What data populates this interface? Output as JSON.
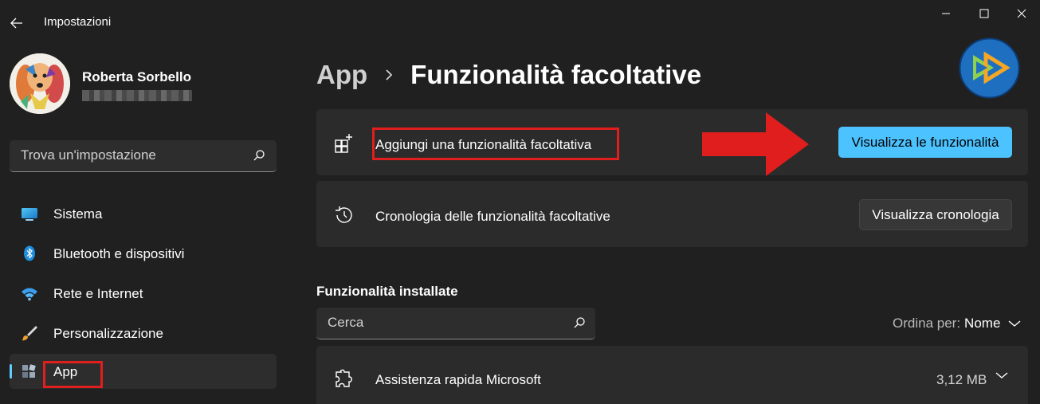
{
  "window": {
    "title": "Impostazioni"
  },
  "user": {
    "name": "Roberta Sorbello"
  },
  "sidebar": {
    "search_placeholder": "Trova un'impostazione",
    "items": [
      {
        "label": "Sistema",
        "icon": "monitor-icon"
      },
      {
        "label": "Bluetooth e dispositivi",
        "icon": "bluetooth-icon"
      },
      {
        "label": "Rete e Internet",
        "icon": "wifi-icon"
      },
      {
        "label": "Personalizzazione",
        "icon": "brush-icon"
      },
      {
        "label": "App",
        "icon": "apps-icon",
        "active": true
      }
    ]
  },
  "breadcrumb": {
    "parent": "App",
    "current": "Funzionalità facoltative"
  },
  "cards": {
    "add_feature": {
      "label": "Aggiungi una funzionalità facoltativa",
      "button": "Visualizza le funzionalità",
      "icon": "add-apps-icon"
    },
    "history": {
      "label": "Cronologia delle funzionalità facoltative",
      "button": "Visualizza cronologia",
      "icon": "history-icon"
    }
  },
  "installed": {
    "title": "Funzionalità installate",
    "search_placeholder": "Cerca",
    "sort_label": "Ordina per:",
    "sort_value": "Nome",
    "features": [
      {
        "name": "Assistenza rapida Microsoft",
        "size": "3,12 MB",
        "icon": "puzzle-icon"
      }
    ]
  },
  "colors": {
    "accent": "#4cc2ff",
    "annotation_red": "#e01e1e",
    "background": "#202020",
    "card": "#2b2b2b"
  }
}
